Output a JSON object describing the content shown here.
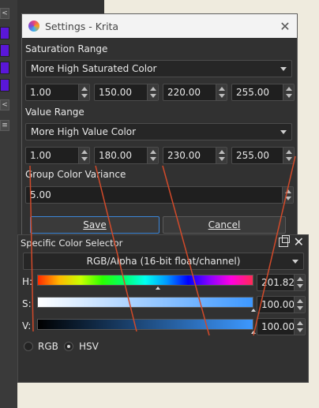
{
  "window": {
    "title": "Settings - Krita",
    "close_glyph": "✕"
  },
  "settings": {
    "saturation": {
      "label": "Saturation Range",
      "mode": "More High Saturated Color",
      "values": [
        "1.00",
        "150.00",
        "220.00",
        "255.00"
      ]
    },
    "value": {
      "label": "Value Range",
      "mode": "More High Value Color",
      "values": [
        "1.00",
        "180.00",
        "230.00",
        "255.00"
      ]
    },
    "variance": {
      "label": "Group Color Variance",
      "value": "5.00"
    },
    "buttons": {
      "save": "Save",
      "cancel": "Cancel"
    }
  },
  "docker": {
    "title": "Specific Color Selector",
    "colorspace": "RGB/Alpha (16-bit float/channel)",
    "channels": [
      {
        "label": "H:",
        "value": "201.82",
        "level": 0.56
      },
      {
        "label": "S:",
        "value": "100.00",
        "level": 1.0
      },
      {
        "label": "V:",
        "value": "100.00",
        "level": 1.0
      }
    ],
    "modes": {
      "rgb": "RGB",
      "hsv": "HSV",
      "selected": "HSV"
    },
    "float_icon": "float-window-icon",
    "close_glyph": "✕"
  },
  "colors": {
    "accent": "#3c86d8",
    "annotation": "#d24a2a",
    "swatch": "#5a17d8"
  }
}
